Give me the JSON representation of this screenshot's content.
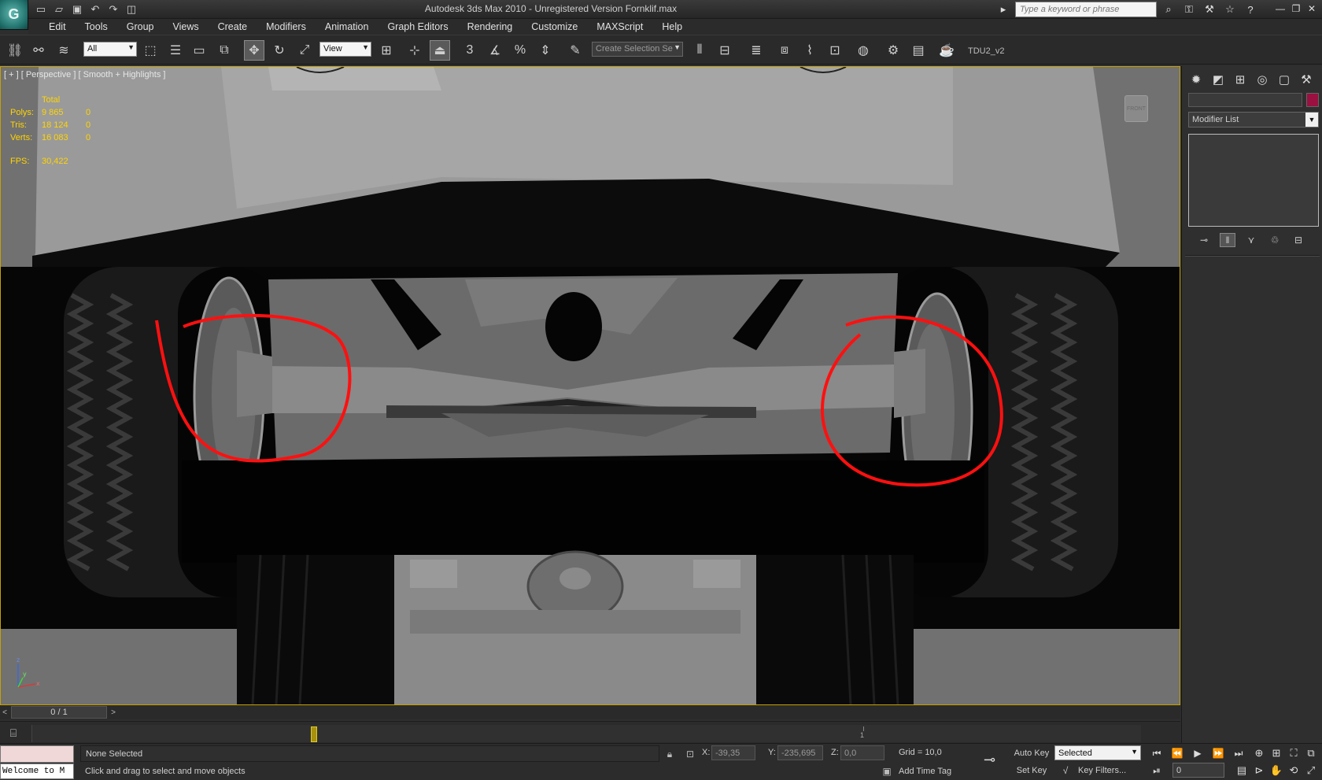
{
  "window": {
    "title": "Autodesk 3ds Max  2010    - Unregistered Version      Fornklif.max",
    "logo_letter": "G",
    "search_placeholder": "Type a keyword or phrase"
  },
  "quick_access": [
    {
      "name": "new-file-icon",
      "glyph": "▭"
    },
    {
      "name": "open-file-icon",
      "glyph": "▱"
    },
    {
      "name": "save-icon",
      "glyph": "▣"
    },
    {
      "name": "undo-icon",
      "glyph": "↶"
    },
    {
      "name": "redo-icon",
      "glyph": "↷"
    },
    {
      "name": "project-folder-icon",
      "glyph": "◫"
    }
  ],
  "menu": [
    "Edit",
    "Tools",
    "Group",
    "Views",
    "Create",
    "Modifiers",
    "Animation",
    "Graph Editors",
    "Rendering",
    "Customize",
    "MAXScript",
    "Help"
  ],
  "toolbar": {
    "selection_filter": "All",
    "reference_coord": "View",
    "named_selection_placeholder": "Create Selection Se",
    "scene_name": "TDU2_v2",
    "snap_label": "3"
  },
  "viewport": {
    "label": "[ + ] [ Perspective ] [ Smooth + Highlights ]",
    "stats_header": "Total",
    "stats": [
      {
        "label": "Polys:",
        "total": "9 865",
        "selected": "0"
      },
      {
        "label": "Tris:",
        "total": "18 124",
        "selected": "0"
      },
      {
        "label": "Verts:",
        "total": "16 083",
        "selected": "0"
      }
    ],
    "fps_label": "FPS:",
    "fps_value": "30,422",
    "viewcube_label": "FRONT",
    "axis_labels": {
      "z": "z",
      "x": "x",
      "y": "y"
    },
    "annotation_color": "#ff1010"
  },
  "command_panel": {
    "tabs": [
      {
        "name": "create-tab-icon",
        "glyph": "✹"
      },
      {
        "name": "modify-tab-icon",
        "glyph": "◩"
      },
      {
        "name": "hierarchy-tab-icon",
        "glyph": "⊞"
      },
      {
        "name": "motion-tab-icon",
        "glyph": "◎"
      },
      {
        "name": "display-tab-icon",
        "glyph": "▢"
      },
      {
        "name": "utilities-tab-icon",
        "glyph": "⚒"
      }
    ],
    "object_color": "#9a1040",
    "modifier_list": "Modifier List"
  },
  "timeline": {
    "frame_display": "0 / 1",
    "track_frame_label": "1"
  },
  "status": {
    "maxscript_listener": "Welcome to M",
    "selection": "None Selected",
    "prompt": "Click and drag to select and move objects",
    "x_label": "X:",
    "x_value": "-39,35",
    "y_label": "Y:",
    "y_value": "-235,695",
    "z_label": "Z:",
    "z_value": "0,0",
    "grid": "Grid = 10,0",
    "add_time_tag": "Add Time Tag",
    "auto_key": "Auto Key",
    "set_key": "Set Key",
    "key_mode": "Selected",
    "key_filters": "Key Filters...",
    "current_frame": "0"
  }
}
